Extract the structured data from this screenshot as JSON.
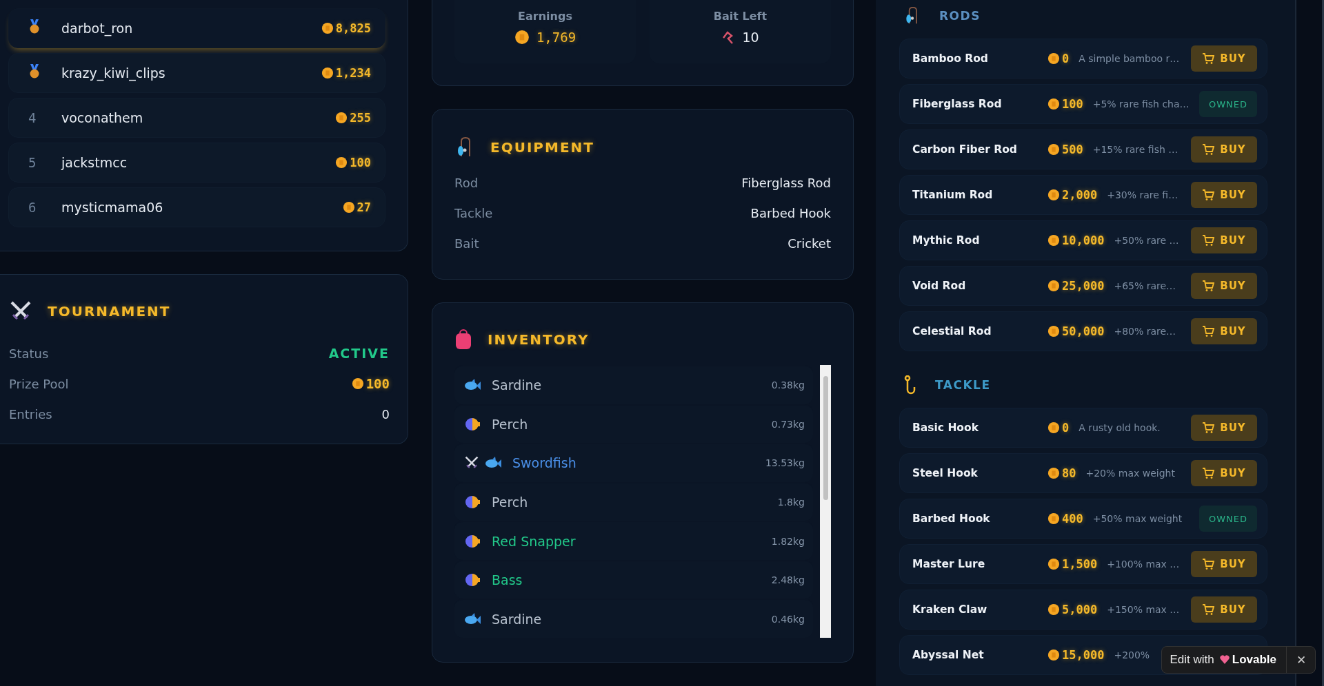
{
  "leaderboard": [
    {
      "kind": "medal",
      "name": "darbot_ron",
      "coins": "8,825",
      "current": true
    },
    {
      "kind": "medal",
      "name": "krazy_kiwi_clips",
      "coins": "1,234",
      "current": false
    },
    {
      "kind": "number",
      "rank": "4",
      "name": "voconathem",
      "coins": "255",
      "current": false
    },
    {
      "kind": "number",
      "rank": "5",
      "name": "jackstmcc",
      "coins": "100",
      "current": false
    },
    {
      "kind": "number",
      "rank": "6",
      "name": "mysticmama06",
      "coins": "27",
      "current": false
    }
  ],
  "tournament": {
    "title": "TOURNAMENT",
    "rows": [
      {
        "kind": "status",
        "label": "Status",
        "value": "ACTIVE"
      },
      {
        "kind": "coins",
        "label": "Prize Pool",
        "value": "100"
      },
      {
        "kind": "plain",
        "label": "Entries",
        "value": "0"
      }
    ]
  },
  "stats": [
    {
      "kind": "coins",
      "label": "Earnings",
      "value": "1,769"
    },
    {
      "kind": "bait",
      "label": "Bait Left",
      "value": "10"
    }
  ],
  "equipment": {
    "title": "EQUIPMENT",
    "rows": [
      {
        "label": "Rod",
        "value": "Fiberglass Rod"
      },
      {
        "label": "Tackle",
        "value": "Barbed Hook"
      },
      {
        "label": "Bait",
        "value": "Cricket"
      }
    ]
  },
  "inventory": {
    "title": "INVENTORY",
    "items": [
      {
        "kind": "slim",
        "name": "Sardine",
        "weight": "0.38kg",
        "color": "#b8c2cf",
        "tournament": false
      },
      {
        "kind": "round",
        "name": "Perch",
        "weight": "0.73kg",
        "color": "#b8c2cf",
        "tournament": false
      },
      {
        "kind": "slim",
        "name": "Swordfish",
        "weight": "13.53kg",
        "color": "#4a8fe8",
        "tournament": true
      },
      {
        "kind": "round",
        "name": "Perch",
        "weight": "1.8kg",
        "color": "#b8c2cf",
        "tournament": false
      },
      {
        "kind": "round",
        "name": "Red Snapper",
        "weight": "1.82kg",
        "color": "#22c98a",
        "tournament": false
      },
      {
        "kind": "round",
        "name": "Bass",
        "weight": "2.48kg",
        "color": "#22c98a",
        "tournament": false
      },
      {
        "kind": "slim",
        "name": "Sardine",
        "weight": "0.46kg",
        "color": "#b8c2cf",
        "tournament": false
      }
    ]
  },
  "shop": [
    {
      "kind": "rod",
      "title": "RODS",
      "items": [
        {
          "name": "Bamboo Rod",
          "price": "0",
          "description": "A simple bamboo r…",
          "owned": false,
          "action": "BUY"
        },
        {
          "name": "Fiberglass Rod",
          "price": "100",
          "description": "+5% rare fish cha…",
          "owned": true,
          "action": "OWNED"
        },
        {
          "name": "Carbon Fiber Rod",
          "price": "500",
          "description": "+15% rare fish …",
          "owned": false,
          "action": "BUY"
        },
        {
          "name": "Titanium Rod",
          "price": "2,000",
          "description": "+30% rare fi…",
          "owned": false,
          "action": "BUY"
        },
        {
          "name": "Mythic Rod",
          "price": "10,000",
          "description": "+50% rare …",
          "owned": false,
          "action": "BUY"
        },
        {
          "name": "Void Rod",
          "price": "25,000",
          "description": "+65% rare…",
          "owned": false,
          "action": "BUY"
        },
        {
          "name": "Celestial Rod",
          "price": "50,000",
          "description": "+80% rare…",
          "owned": false,
          "action": "BUY"
        }
      ]
    },
    {
      "kind": "hook",
      "title": "TACKLE",
      "items": [
        {
          "name": "Basic Hook",
          "price": "0",
          "description": "A rusty old hook.",
          "owned": false,
          "action": "BUY"
        },
        {
          "name": "Steel Hook",
          "price": "80",
          "description": "+20% max weight",
          "owned": false,
          "action": "BUY"
        },
        {
          "name": "Barbed Hook",
          "price": "400",
          "description": "+50% max weight",
          "owned": true,
          "action": "OWNED"
        },
        {
          "name": "Master Lure",
          "price": "1,500",
          "description": "+100% max …",
          "owned": false,
          "action": "BUY"
        },
        {
          "name": "Kraken Claw",
          "price": "5,000",
          "description": "+150% max …",
          "owned": false,
          "action": "BUY"
        },
        {
          "name": "Abyssal Net",
          "price": "15,000",
          "description": "+200%"
        }
      ]
    }
  ],
  "badge": {
    "prefix": "Edit with",
    "brand": "Lovable",
    "close": "✕"
  }
}
